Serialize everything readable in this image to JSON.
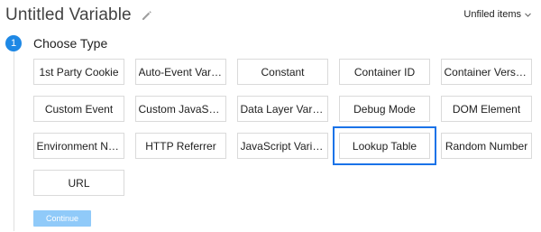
{
  "header": {
    "title": "Untitled Variable",
    "unfiled_label": "Unfiled items"
  },
  "step": {
    "number": "1",
    "title": "Choose Type"
  },
  "types": [
    "1st Party Cookie",
    "Auto-Event Varia...",
    "Constant",
    "Container ID",
    "Container Versio...",
    "Custom Event",
    "Custom JavaScri...",
    "Data Layer Varia...",
    "Debug Mode",
    "DOM Element",
    "Environment Na...",
    "HTTP Referrer",
    "JavaScript Varia...",
    "Lookup Table",
    "Random Number",
    "URL"
  ],
  "selected_type": "Lookup Table",
  "actions": {
    "continue_label": "Continue"
  },
  "colors": {
    "accent": "#1e88e5",
    "selected_outline": "#1a73e8",
    "continue_disabled": "#90caf9"
  }
}
